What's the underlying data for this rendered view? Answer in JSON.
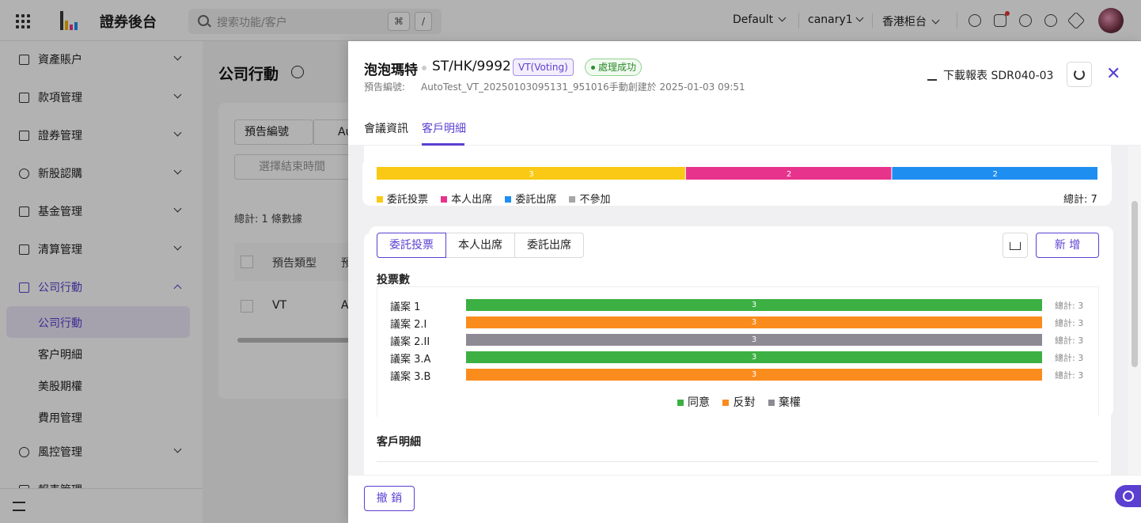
{
  "header": {
    "brand": "證券後台",
    "search_placeholder": "搜索功能/客户",
    "shortcut_cmd": "⌘",
    "shortcut_slash": "/",
    "theme_select": "Default",
    "env_select": "canary1",
    "counter_select": "香港柜台",
    "icons": [
      "command-icon",
      "document-alert-icon",
      "cloud-download-icon",
      "help-icon",
      "settings-icon",
      "avatar"
    ]
  },
  "sidebar": {
    "items": [
      {
        "label": "資產賬户"
      },
      {
        "label": "款項管理"
      },
      {
        "label": "證券管理"
      },
      {
        "label": "新股認購"
      },
      {
        "label": "基金管理"
      },
      {
        "label": "清算管理"
      },
      {
        "label": "公司行動",
        "open": true
      },
      {
        "label": "風控管理"
      },
      {
        "label": "報表管理"
      }
    ],
    "sub_items": [
      "公司行動",
      "客户明細",
      "美股期權",
      "費用管理"
    ]
  },
  "background_page": {
    "title": "公司行動",
    "filter_select": "預告編號",
    "filter_input_value": "Au",
    "date_placeholder": "選擇結束時間",
    "total_text": "總計: 1 條數據",
    "table_headers": [
      "預告類型",
      "預"
    ],
    "table_row": [
      "VT",
      "A"
    ]
  },
  "drawer": {
    "stock_name": "泡泡瑪特",
    "stock_code": "ST/HK/9992",
    "type_tag": "VT(Voting)",
    "status_tag": "處理成功",
    "meta_prefix": "預告編號:",
    "meta_value": "AutoTest_VT_20250103095131_951016手動創建於 2025-01-03 09:51",
    "download_label": "下載報表 SDR040-03",
    "tabs": [
      "會議資訊",
      "客戶明細"
    ],
    "active_tab": "客戶明細",
    "attendance": {
      "segments": [
        {
          "value": 3,
          "color": "#fac915"
        },
        {
          "value": 2,
          "color": "#e8338c"
        },
        {
          "value": 2,
          "color": "#1f8ef1"
        }
      ],
      "legend": [
        "委託投票",
        "本人出席",
        "委託出席",
        "不參加"
      ],
      "legend_colors": [
        "#fac915",
        "#e8338c",
        "#1f8ef1",
        "#a6a6a6"
      ],
      "total_text": "總計: 7"
    },
    "vote_tabs": [
      "委託投票",
      "本人出席",
      "委託出席"
    ],
    "active_vote_tab": "委託投票",
    "add_button": "新 增",
    "section_title": "投票數",
    "chart_data": {
      "type": "bar",
      "categories": [
        "議案 1",
        "議案 2.I",
        "議案 2.II",
        "議案 3.A",
        "議案 3.B"
      ],
      "values": [
        3,
        3,
        3,
        3,
        3
      ],
      "bar_colors": [
        "#3cb043",
        "#fa8c1e",
        "#8e8a93",
        "#3cb043",
        "#fa8c1e"
      ],
      "row_totals": [
        "總計: 3",
        "總計: 3",
        "總計: 3",
        "總計: 3",
        "總計: 3"
      ],
      "legend": [
        "同意",
        "反對",
        "棄權"
      ],
      "legend_colors": [
        "#3cb043",
        "#fa8c1e",
        "#8e8a93"
      ]
    },
    "client_section_title": "客戶明細",
    "revoke_button": "撤 銷"
  },
  "colors": {
    "accent": "#5b3fd1"
  }
}
